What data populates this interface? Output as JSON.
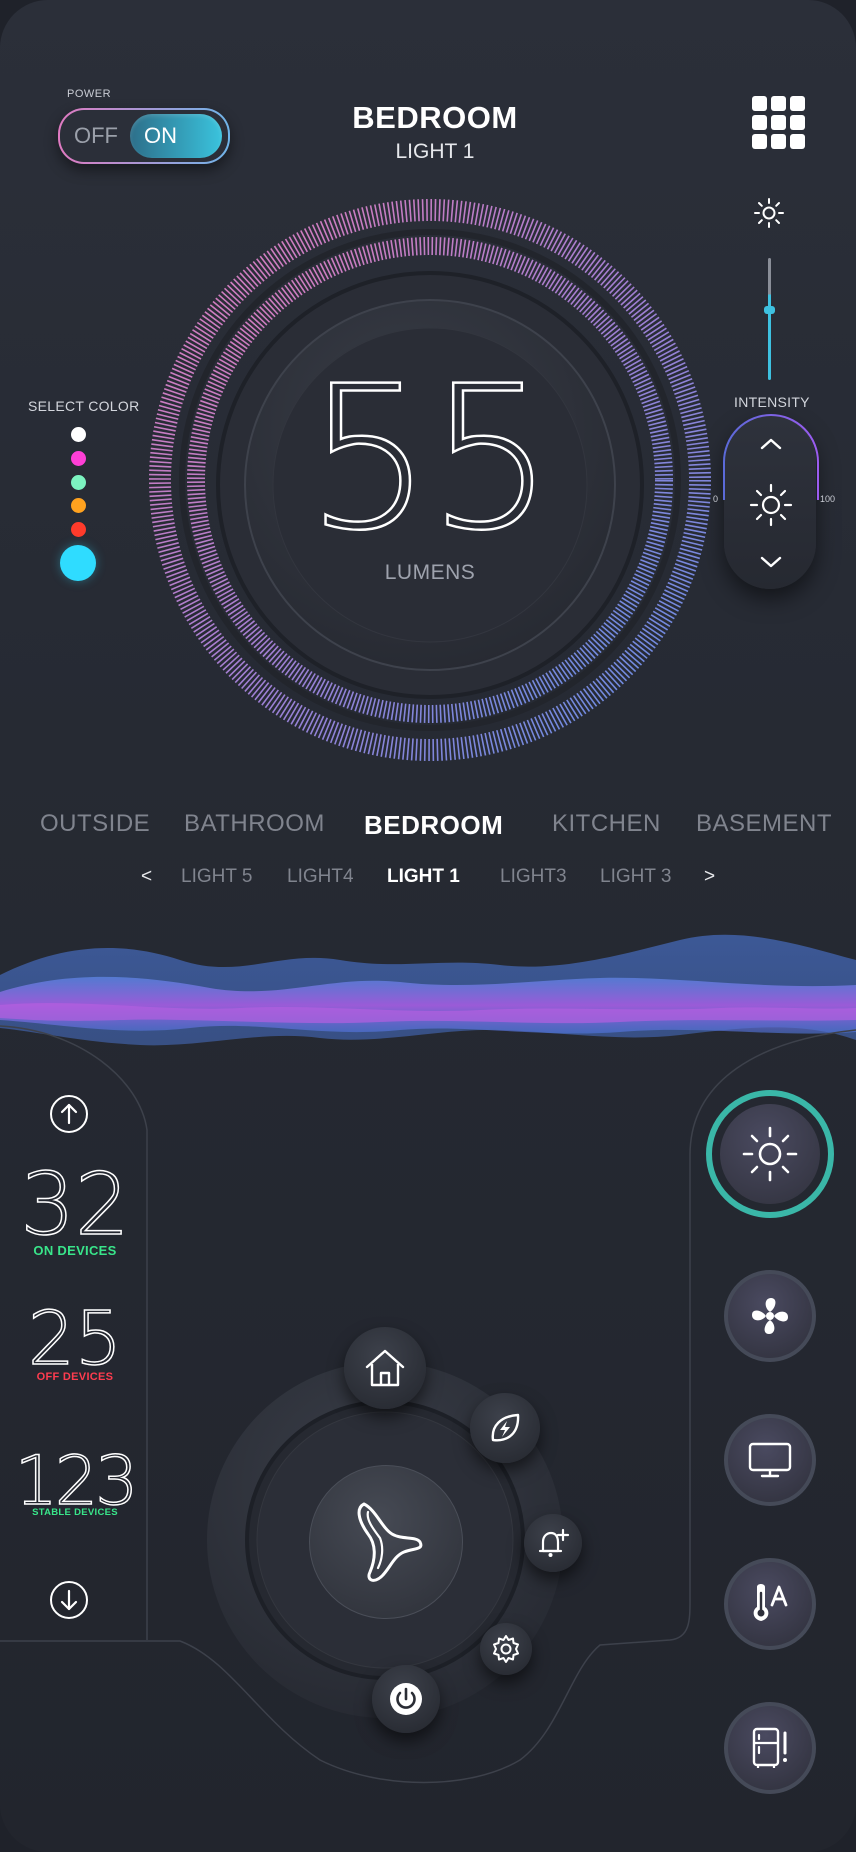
{
  "header": {
    "power_label": "POWER",
    "toggle_off": "OFF",
    "toggle_on": "ON",
    "room_title": "BEDROOM",
    "light_title": "LIGHT 1"
  },
  "color_picker": {
    "label": "SELECT COLOR",
    "swatches": [
      "#ffffff",
      "#ff3fd6",
      "#7cf3c0",
      "#ffa21f",
      "#ff3b2b",
      "#2fdcff"
    ],
    "selected": "#2fdcff"
  },
  "intensity": {
    "label": "INTENSITY",
    "min": "0",
    "max": "100",
    "slider_level": 0.7
  },
  "lumens": {
    "value": "55",
    "label": "LUMENS"
  },
  "rooms": [
    "OUTSIDE",
    "BATHROOM",
    "BEDROOM",
    "KITCHEN",
    "BASEMENT"
  ],
  "lights": {
    "prev": "<",
    "next": ">",
    "items": [
      "LIGHT 5",
      "LIGHT4",
      "LIGHT 1",
      "LIGHT3",
      "LIGHT 3"
    ]
  },
  "stats": {
    "on": {
      "value": "32",
      "label": "ON DEVICES",
      "color": "#39e58a"
    },
    "off": {
      "value": "25",
      "label": "OFF DEVICES",
      "color": "#ff3c4f"
    },
    "stable": {
      "value": "123",
      "label": "STABLE DEVICES",
      "color": "#39e58a"
    }
  },
  "device_buttons": [
    "light-icon",
    "fan-icon",
    "tv-icon",
    "thermostat-icon",
    "fridge-icon"
  ],
  "hub_menu": [
    "home-icon",
    "energy-leaf-icon",
    "bell-plus-icon",
    "gear-icon",
    "power-icon"
  ],
  "colors": {
    "accent": "#3ac3dd",
    "selected_ring": "#3ab7a8",
    "pink": "#d97ab8",
    "blue": "#5f8ee3"
  }
}
